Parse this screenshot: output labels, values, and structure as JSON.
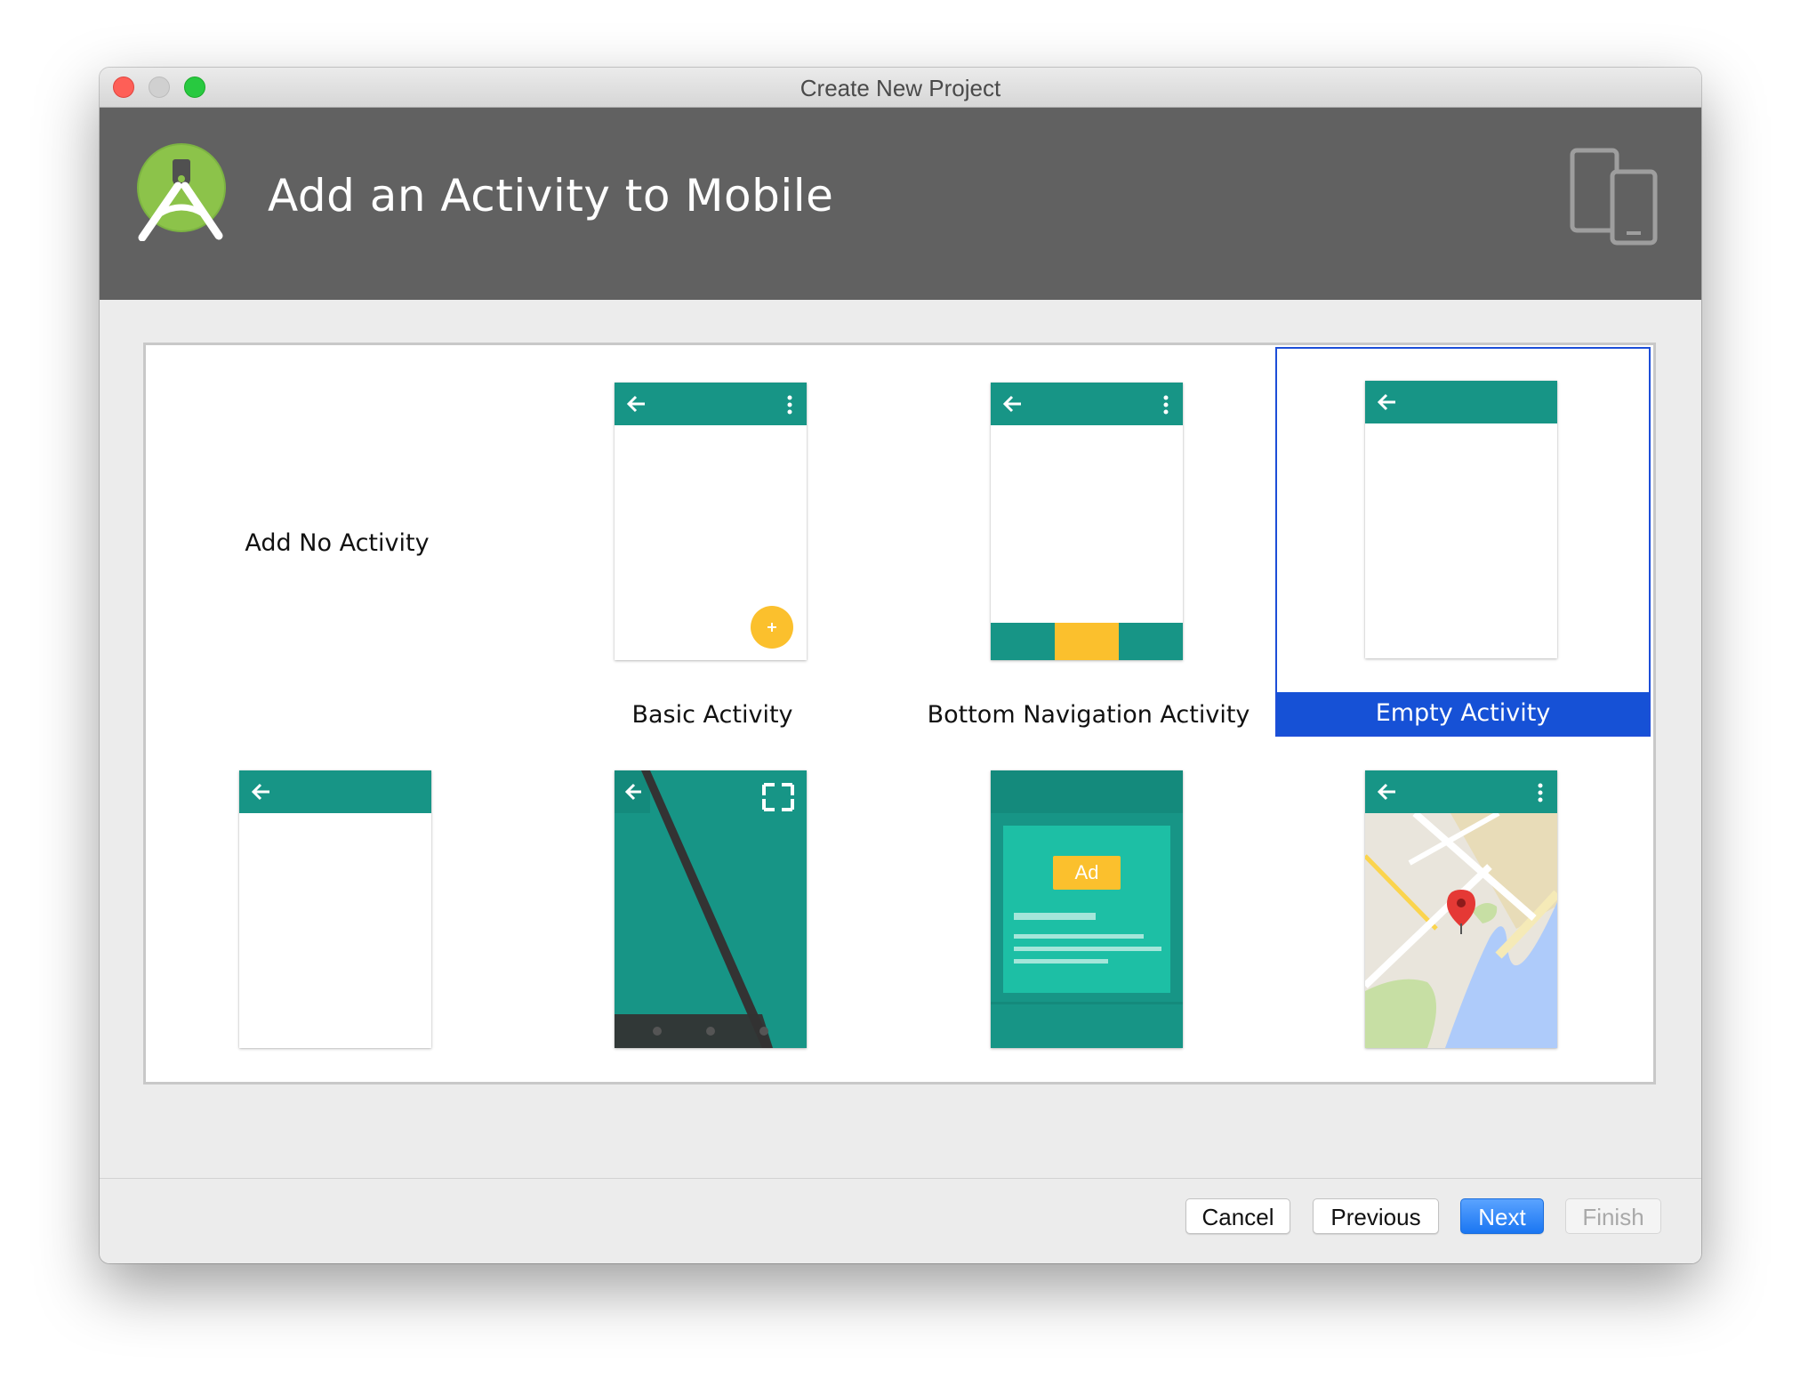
{
  "window": {
    "title": "Create New Project"
  },
  "header": {
    "title": "Add an Activity to Mobile"
  },
  "activities": [
    {
      "label": "Add No Activity",
      "template": "none",
      "selected": false
    },
    {
      "label": "Basic Activity",
      "template": "basic",
      "selected": false
    },
    {
      "label": "Bottom Navigation Activity",
      "template": "bottom-navigation",
      "selected": false
    },
    {
      "label": "Empty Activity",
      "template": "empty",
      "selected": true
    },
    {
      "label": "",
      "template": "empty-no-menu",
      "selected": false
    },
    {
      "label": "",
      "template": "fullscreen",
      "selected": false
    },
    {
      "label": "",
      "template": "admob-ads",
      "selected": false
    },
    {
      "label": "",
      "template": "google-maps",
      "selected": false
    }
  ],
  "ad_badge": "Ad",
  "buttons": {
    "cancel": "Cancel",
    "previous": "Previous",
    "next": "Next",
    "finish": "Finish"
  },
  "colors": {
    "header_bg": "#616161",
    "appbar_teal": "#179586",
    "fab_yellow": "#fbc02d",
    "selection_blue": "#1651d6",
    "next_button_blue": "#1a76f2"
  }
}
